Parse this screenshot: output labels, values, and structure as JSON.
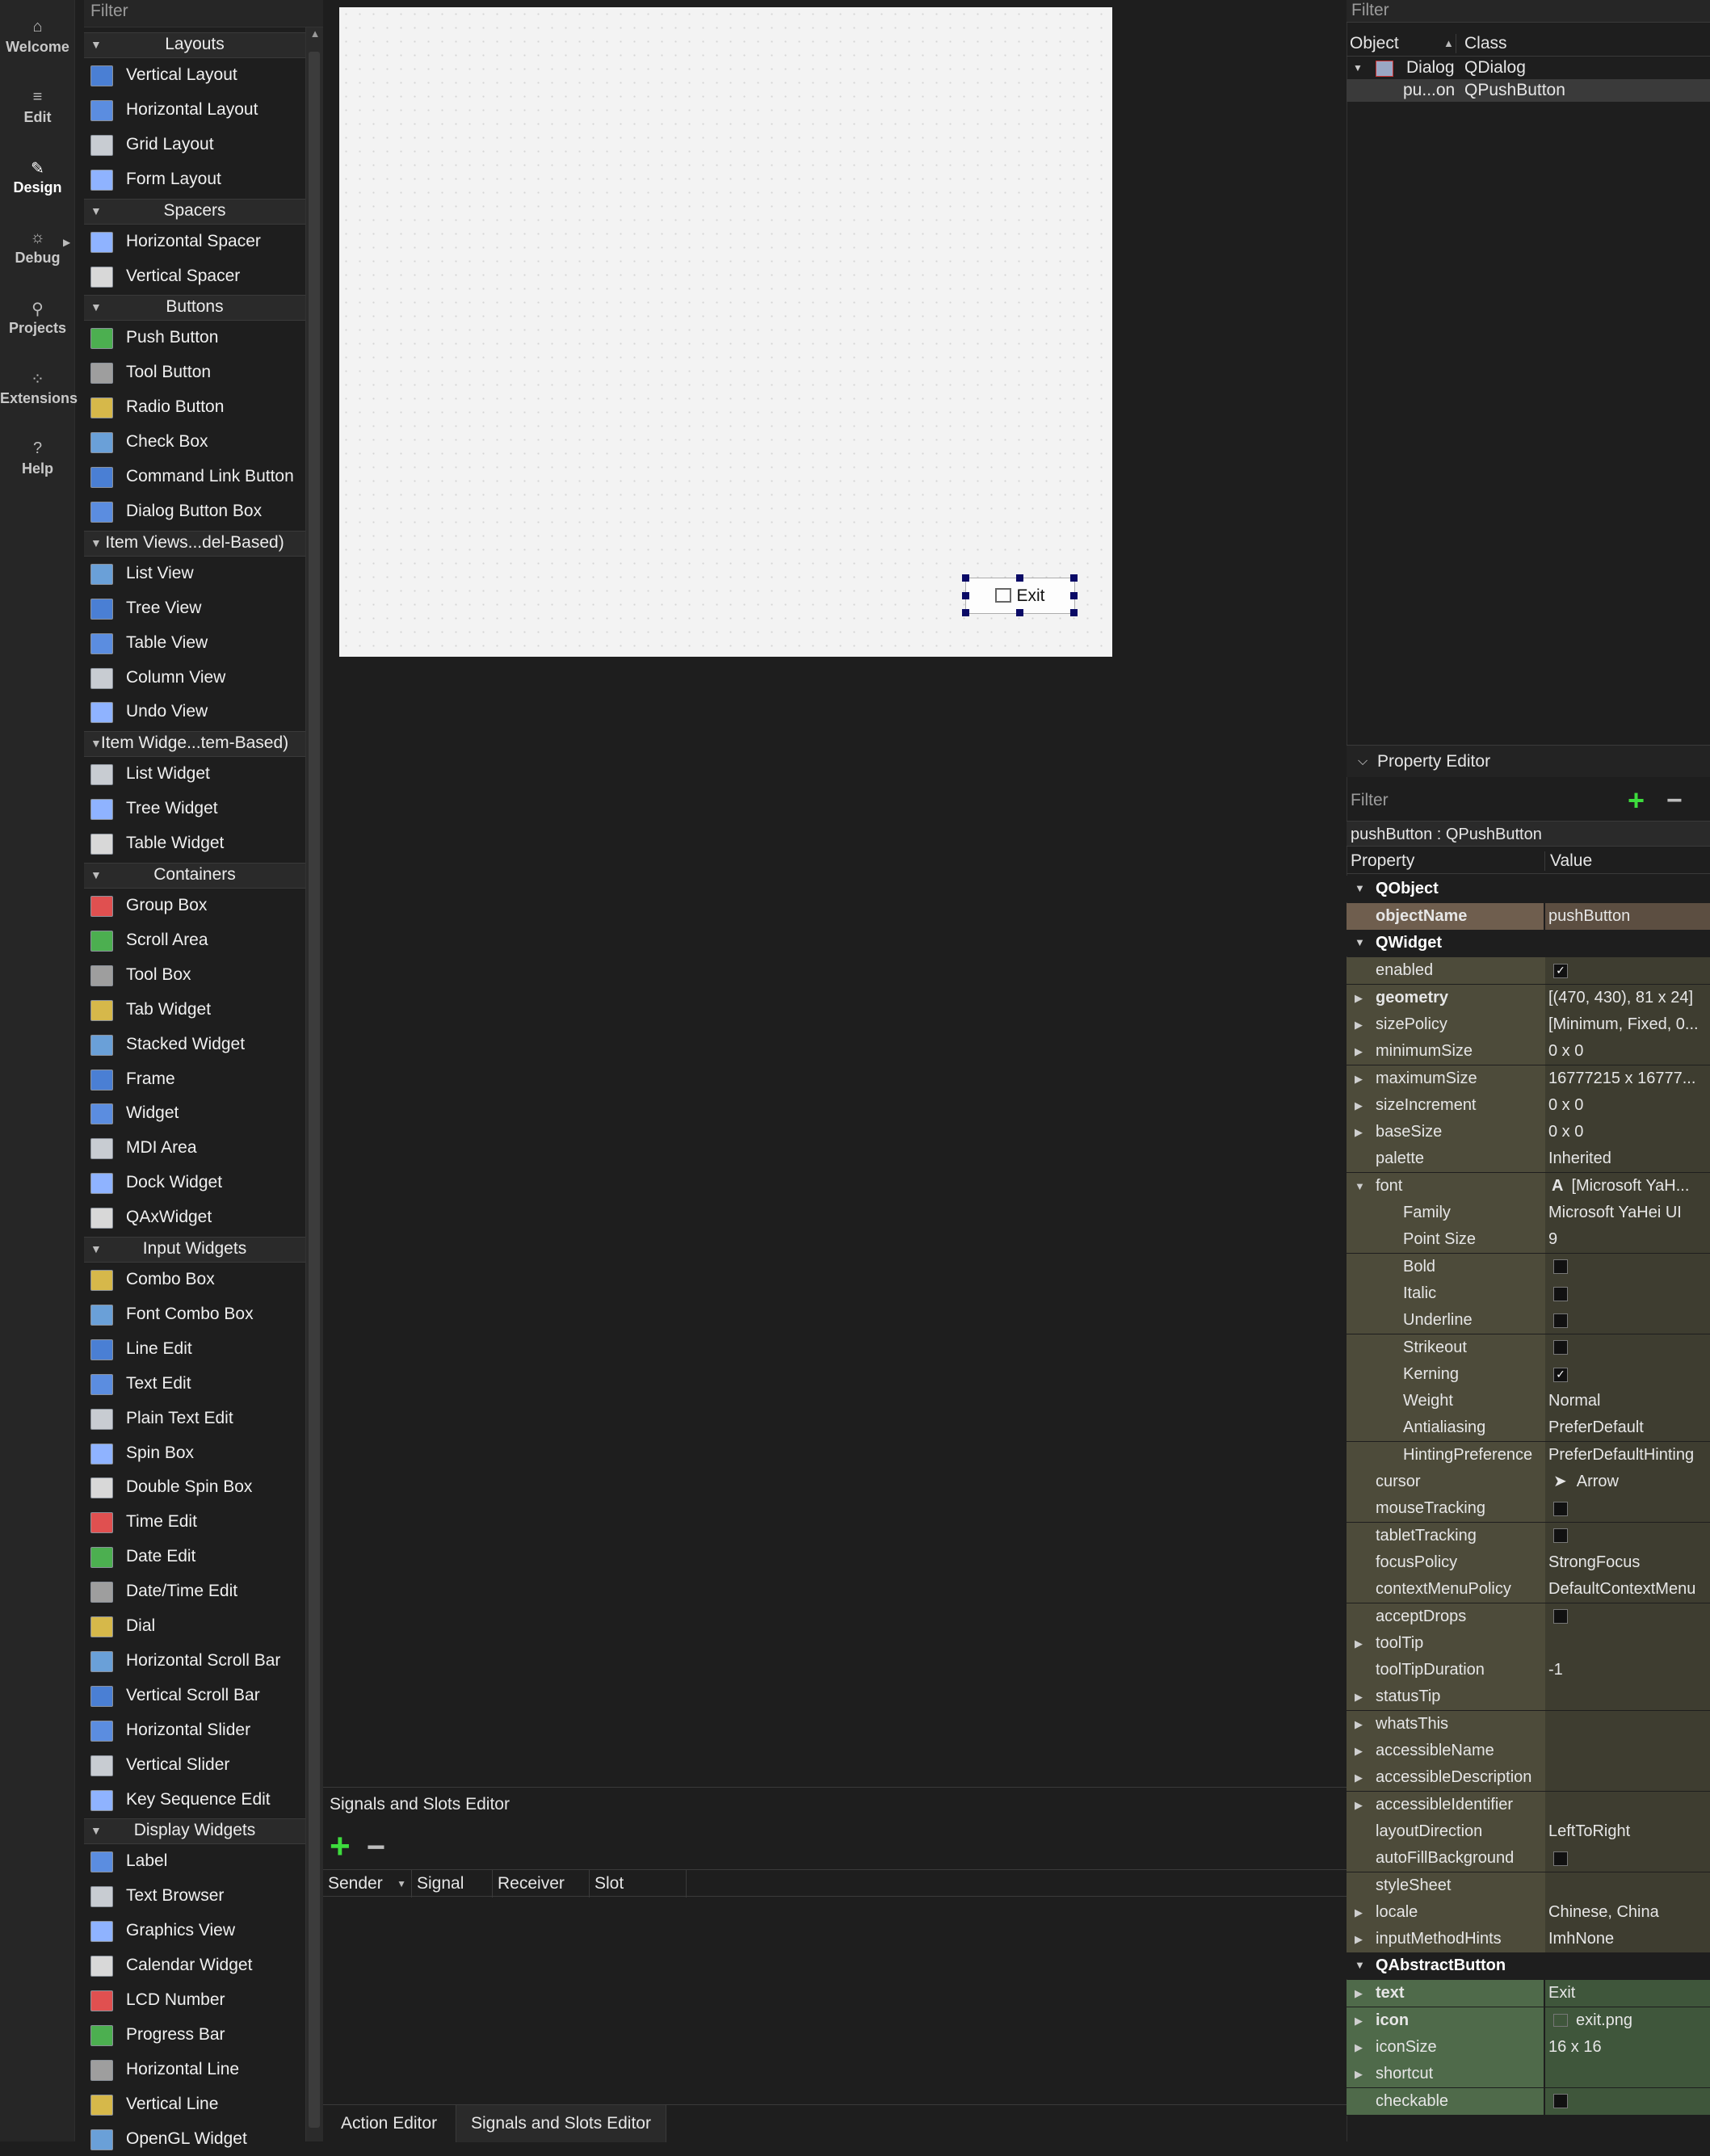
{
  "modebar": {
    "items": [
      {
        "label": "Welcome",
        "icon": "home-icon"
      },
      {
        "label": "Edit",
        "icon": "edit-icon"
      },
      {
        "label": "Design",
        "icon": "pen-icon"
      },
      {
        "label": "Debug",
        "icon": "bug-icon"
      },
      {
        "label": "Projects",
        "icon": "wrench-icon"
      },
      {
        "label": "Extensions",
        "icon": "extensions-icon"
      },
      {
        "label": "Help",
        "icon": "help-icon"
      }
    ]
  },
  "widgetbox": {
    "filter_placeholder": "Filter",
    "categories": [
      {
        "name": "Layouts",
        "items": [
          "Vertical Layout",
          "Horizontal Layout",
          "Grid Layout",
          "Form Layout"
        ]
      },
      {
        "name": "Spacers",
        "items": [
          "Horizontal Spacer",
          "Vertical Spacer"
        ]
      },
      {
        "name": "Buttons",
        "items": [
          "Push Button",
          "Tool Button",
          "Radio Button",
          "Check Box",
          "Command Link Button",
          "Dialog Button Box"
        ]
      },
      {
        "name": "Item Views...del-Based)",
        "items": [
          "List View",
          "Tree View",
          "Table View",
          "Column View",
          "Undo View"
        ]
      },
      {
        "name": "Item Widge...tem-Based)",
        "items": [
          "List Widget",
          "Tree Widget",
          "Table Widget"
        ]
      },
      {
        "name": "Containers",
        "items": [
          "Group Box",
          "Scroll Area",
          "Tool Box",
          "Tab Widget",
          "Stacked Widget",
          "Frame",
          "Widget",
          "MDI Area",
          "Dock Widget",
          "QAxWidget"
        ]
      },
      {
        "name": "Input Widgets",
        "items": [
          "Combo Box",
          "Font Combo Box",
          "Line Edit",
          "Text Edit",
          "Plain Text Edit",
          "Spin Box",
          "Double Spin Box",
          "Time Edit",
          "Date Edit",
          "Date/Time Edit",
          "Dial",
          "Horizontal Scroll Bar",
          "Vertical Scroll Bar",
          "Horizontal Slider",
          "Vertical Slider",
          "Key Sequence Edit"
        ]
      },
      {
        "name": "Display Widgets",
        "items": [
          "Label",
          "Text Browser",
          "Graphics View",
          "Calendar Widget",
          "LCD Number",
          "Progress Bar",
          "Horizontal Line",
          "Vertical Line",
          "OpenGL Widget"
        ]
      }
    ]
  },
  "form": {
    "exit_button_label": "Exit"
  },
  "signals_slots": {
    "title": "Signals and Slots Editor",
    "columns": [
      "Sender",
      "Signal",
      "Receiver",
      "Slot"
    ]
  },
  "bottom_tabs": [
    "Action Editor",
    "Signals and Slots Editor"
  ],
  "object_inspector": {
    "filter_placeholder": "Filter",
    "col_object": "Object",
    "col_class": "Class",
    "rows": [
      {
        "object": "Dialog",
        "class": "QDialog"
      },
      {
        "object": "pu...on",
        "class": "QPushButton"
      }
    ]
  },
  "property_editor": {
    "title": "Property Editor",
    "filter_placeholder": "Filter",
    "object_label": "pushButton : QPushButton",
    "col_property": "Property",
    "col_value": "Value",
    "sections": [
      {
        "name": "QObject",
        "style": "o",
        "rows": [
          {
            "name": "objectName",
            "value": "pushButton",
            "bold": true
          }
        ]
      },
      {
        "name": "QWidget",
        "style": "w",
        "rows": [
          {
            "name": "enabled",
            "check": true
          },
          {
            "name": "geometry",
            "value": "[(470, 430), 81 x 24]",
            "bold": true,
            "expand": "right"
          },
          {
            "name": "sizePolicy",
            "value": "[Minimum, Fixed, 0...",
            "expand": "right"
          },
          {
            "name": "minimumSize",
            "value": "0 x 0",
            "expand": "right"
          },
          {
            "name": "maximumSize",
            "value": "16777215 x 16777...",
            "expand": "right"
          },
          {
            "name": "sizeIncrement",
            "value": "0 x 0",
            "expand": "right"
          },
          {
            "name": "baseSize",
            "value": "0 x 0",
            "expand": "right"
          },
          {
            "name": "palette",
            "value": "Inherited"
          },
          {
            "name": "font",
            "value": "[Microsoft YaH...",
            "expand": "down",
            "fonticon": true
          },
          {
            "name": "Family",
            "value": "Microsoft YaHei UI",
            "sub": true
          },
          {
            "name": "Point Size",
            "value": "9",
            "sub": true
          },
          {
            "name": "Bold",
            "check": false,
            "sub": true
          },
          {
            "name": "Italic",
            "check": false,
            "sub": true
          },
          {
            "name": "Underline",
            "check": false,
            "sub": true
          },
          {
            "name": "Strikeout",
            "check": false,
            "sub": true
          },
          {
            "name": "Kerning",
            "check": true,
            "sub": true
          },
          {
            "name": "Weight",
            "value": "Normal",
            "sub": true
          },
          {
            "name": "Antialiasing",
            "value": "PreferDefault",
            "sub": true
          },
          {
            "name": "HintingPreference",
            "value": "PreferDefaultHinting",
            "sub": true
          },
          {
            "name": "cursor",
            "value": "Arrow",
            "cursoricon": true
          },
          {
            "name": "mouseTracking",
            "check": false
          },
          {
            "name": "tabletTracking",
            "check": false
          },
          {
            "name": "focusPolicy",
            "value": "StrongFocus"
          },
          {
            "name": "contextMenuPolicy",
            "value": "DefaultContextMenu"
          },
          {
            "name": "acceptDrops",
            "check": false
          },
          {
            "name": "toolTip",
            "value": "",
            "expand": "right"
          },
          {
            "name": "toolTipDuration",
            "value": "-1"
          },
          {
            "name": "statusTip",
            "value": "",
            "expand": "right"
          },
          {
            "name": "whatsThis",
            "value": "",
            "expand": "right"
          },
          {
            "name": "accessibleName",
            "value": "",
            "expand": "right"
          },
          {
            "name": "accessibleDescription",
            "value": "",
            "expand": "right"
          },
          {
            "name": "accessibleIdentifier",
            "value": "",
            "expand": "right"
          },
          {
            "name": "layoutDirection",
            "value": "LeftToRight"
          },
          {
            "name": "autoFillBackground",
            "check": false
          },
          {
            "name": "styleSheet",
            "value": ""
          },
          {
            "name": "locale",
            "value": "Chinese, China",
            "expand": "right"
          },
          {
            "name": "inputMethodHints",
            "value": "ImhNone",
            "expand": "right"
          }
        ]
      },
      {
        "name": "QAbstractButton",
        "style": "a",
        "rows": [
          {
            "name": "text",
            "value": "Exit",
            "bold": true,
            "expand": "right"
          },
          {
            "name": "icon",
            "value": "exit.png",
            "bold": true,
            "expand": "right",
            "imgicon": true
          },
          {
            "name": "iconSize",
            "value": "16 x 16",
            "expand": "right"
          },
          {
            "name": "shortcut",
            "value": "",
            "expand": "right"
          },
          {
            "name": "checkable",
            "check": false
          }
        ]
      }
    ]
  }
}
